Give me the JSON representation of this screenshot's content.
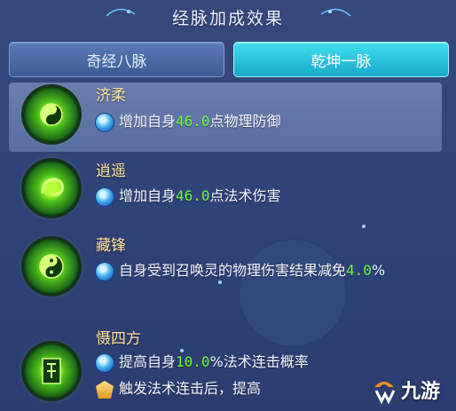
{
  "title": "经脉加成效果",
  "tabs": [
    {
      "label": "奇经八脉"
    },
    {
      "label": "乾坤一脉"
    }
  ],
  "skills": [
    {
      "name": "济柔",
      "effects": [
        {
          "pre": "增加自身",
          "num": "46.0",
          "post": "点物理防御"
        }
      ]
    },
    {
      "name": "逍遥",
      "effects": [
        {
          "pre": "增加自身",
          "num": "46.0",
          "post": "点法术伤害"
        }
      ]
    },
    {
      "name": "藏锋",
      "effects": [
        {
          "pre": "自身受到召唤灵的物理伤害结果减免",
          "num": "4.0",
          "post": "%"
        }
      ]
    },
    {
      "name": "慑四方",
      "effects": [
        {
          "pre": "提高自身",
          "num": "10.0",
          "post": "%法术连击概率"
        },
        {
          "pre": "触发法术连击后，提高",
          "num": "",
          "post": ""
        }
      ]
    }
  ],
  "watermark": {
    "text": "九游"
  },
  "colors": {
    "tab_active": "#18a9c9",
    "tab_inactive": "#3f5a94",
    "skill_name": "#ffe39a",
    "number": "#6dff3a"
  },
  "icons": {
    "bullet": "blue-orb-icon",
    "bullet_gold": "gold-gem-icon",
    "skill_1": "bagua-icon",
    "skill_2": "swirl-icon",
    "skill_3": "yinyang-icon",
    "skill_4": "rune-icon"
  }
}
